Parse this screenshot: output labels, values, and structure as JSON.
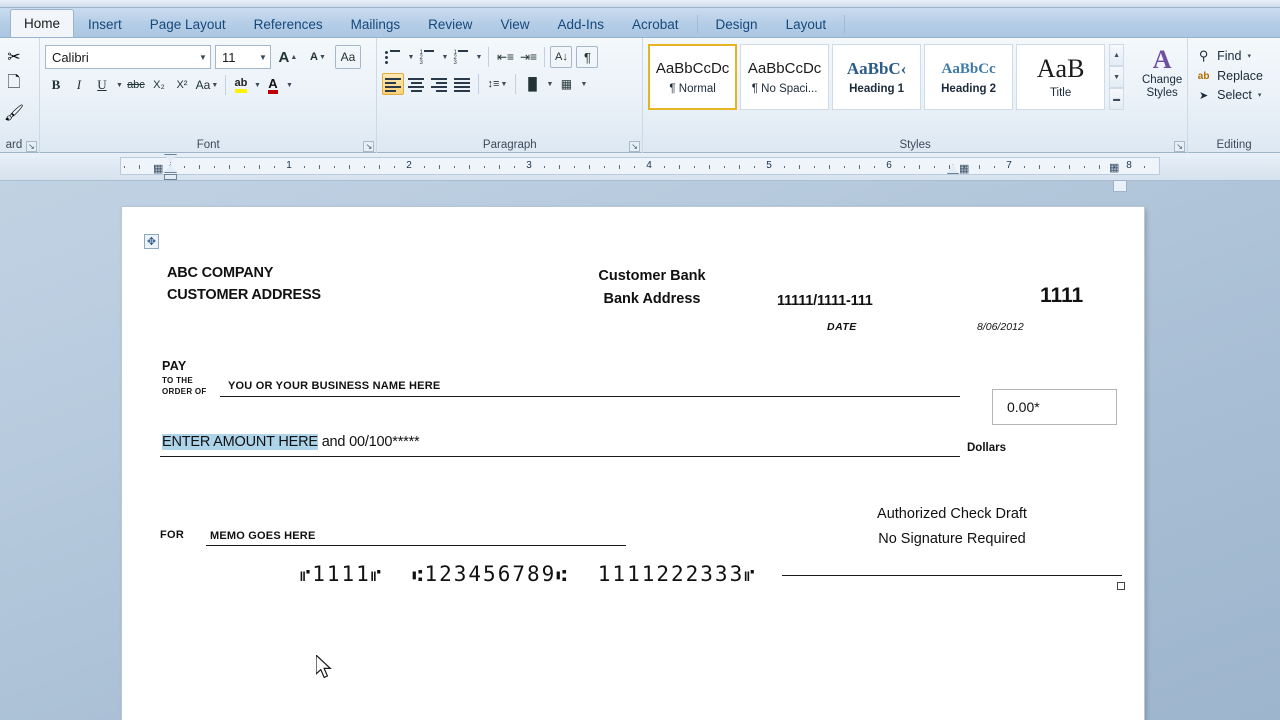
{
  "app": {
    "name": "Microsoft Word 2010",
    "tabs": [
      {
        "label": "Home",
        "active": true
      },
      {
        "label": "Insert",
        "active": false
      },
      {
        "label": "Page Layout",
        "active": false
      },
      {
        "label": "References",
        "active": false
      },
      {
        "label": "Mailings",
        "active": false
      },
      {
        "label": "Review",
        "active": false
      },
      {
        "label": "View",
        "active": false
      },
      {
        "label": "Add-Ins",
        "active": false
      },
      {
        "label": "Acrobat",
        "active": false
      },
      {
        "label": "Design",
        "active": false
      },
      {
        "label": "Layout",
        "active": false
      }
    ]
  },
  "ribbon": {
    "clipboard": {
      "label": "ard",
      "cut_icon": "scissors-icon",
      "copy_icon": "copy-icon",
      "format_painter_icon": "paintbrush-icon",
      "dialog_launcher": "↘"
    },
    "font": {
      "label": "Font",
      "font_name": "Calibri",
      "font_size": "11",
      "grow_font": "A",
      "shrink_font": "A",
      "clear_formatting": "Aa",
      "bold": "B",
      "italic": "I",
      "underline": "U",
      "strikethrough": "abc",
      "subscript": "X₂",
      "superscript": "X²",
      "change_case": "Aa",
      "text_highlight": "ab",
      "font_color": "A",
      "dialog_launcher": "↘"
    },
    "paragraph": {
      "label": "Paragraph",
      "bullets": "bullets-icon",
      "numbering": "numbering-icon",
      "multilevel": "multilevel-list-icon",
      "decrease_indent": "decrease-indent-icon",
      "increase_indent": "increase-indent-icon",
      "sort": "sort-icon",
      "show_marks": "¶",
      "align_left": "align-left-icon",
      "align_center": "align-center-icon",
      "align_right": "align-right-icon",
      "justify": "justify-icon",
      "line_spacing": "line-spacing-icon",
      "shading": "shading-icon",
      "borders": "borders-icon",
      "dialog_launcher": "↘"
    },
    "styles": {
      "label": "Styles",
      "dialog_launcher": "↘",
      "items": [
        {
          "sample": "AaBbCcDc",
          "name": "¶ Normal",
          "selected": true
        },
        {
          "sample": "AaBbCcDc",
          "name": "¶ No Spaci...",
          "selected": false
        },
        {
          "sample": "AaBbC‹",
          "name": "Heading 1",
          "selected": false
        },
        {
          "sample": "AaBbCc",
          "name": "Heading 2",
          "selected": false
        },
        {
          "sample": "AaB",
          "name": "Title",
          "selected": false
        }
      ],
      "scroll_up": "▲",
      "scroll_down": "▼",
      "more": "▬",
      "change_styles": "Change Styles"
    },
    "editing": {
      "label": "Editing",
      "items": [
        {
          "icon": "binoculars-icon",
          "glyph": "⚲",
          "label": "Find",
          "caret": "▾"
        },
        {
          "icon": "replace-icon",
          "glyph": "ab",
          "label": "Replace",
          "caret": ""
        },
        {
          "icon": "select-arrow-icon",
          "glyph": "➤",
          "label": "Select",
          "caret": "▾"
        }
      ]
    }
  },
  "ruler": {
    "numbers": [
      "1",
      "2",
      "3",
      "4",
      "5",
      "6",
      "7",
      "8"
    ],
    "unit": "inches",
    "left_indent_marker": "hourglass-indent-marker",
    "right_indent_marker": "right-indent-marker"
  },
  "document": {
    "move_handle_icon": "move-handle-icon",
    "check": {
      "company_name": "ABC COMPANY",
      "company_address": "CUSTOMER ADDRESS",
      "bank_name": "Customer Bank",
      "bank_address": "Bank Address",
      "routing_fraction": "11111/1111-111",
      "check_number": "1111",
      "date_label": "DATE",
      "date_value": "8/06/2012",
      "pay_label": "PAY",
      "to_the_order_of": "TO THE\nORDER OF",
      "to_the": "TO THE",
      "order_of": "ORDER OF",
      "payee": "YOU OR YOUR BUSINESS NAME HERE",
      "amount_numeric": "0.00*",
      "amount_words_selected": "ENTER AMOUNT HERE",
      "amount_words_rest": " and 00/100*****",
      "dollars_label": "Dollars",
      "authorized_line1": "Authorized Check Draft",
      "authorized_line2": "No Signature Required",
      "for_label": "FOR",
      "memo": "MEMO GOES HERE",
      "micr_check_number": "1111",
      "micr_routing": "123456789",
      "micr_account": "1111222333",
      "micr_transit_symbol": "⑆",
      "micr_onus_symbol": "⑈"
    }
  },
  "colors": {
    "selection_highlight": "#aed4ea",
    "ribbon_tab_bar": "#b7cee7",
    "active_tab": "#f2f6fa",
    "style_selected_border": "#e6b422",
    "page_background": "#ffffff",
    "desktop_background": "#a8bed4"
  }
}
